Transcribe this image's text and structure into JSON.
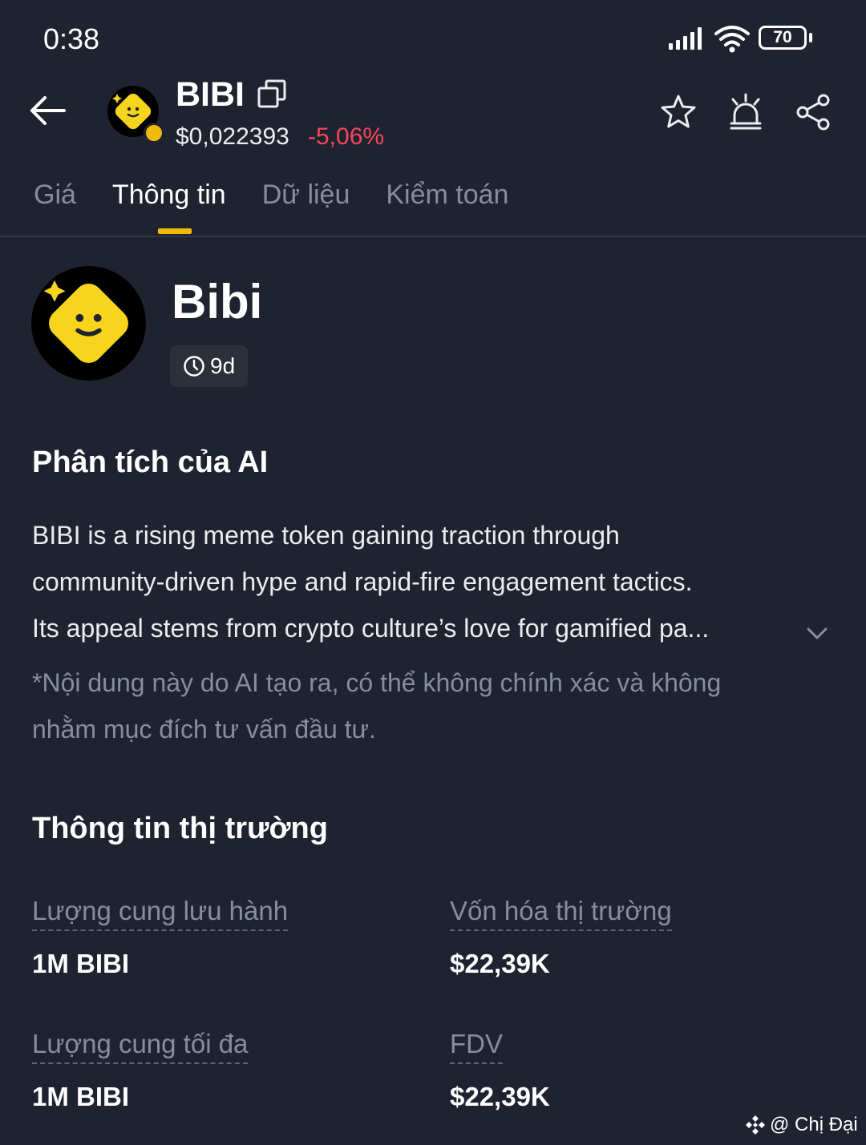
{
  "status_bar": {
    "time": "0:38",
    "battery": "70"
  },
  "header": {
    "symbol": "BIBI",
    "price": "$0,022393",
    "change": "-5,06%"
  },
  "tabs": [
    {
      "label": "Giá",
      "active": false
    },
    {
      "label": "Thông tin",
      "active": true
    },
    {
      "label": "Dữ liệu",
      "active": false
    },
    {
      "label": "Kiểm toán",
      "active": false
    }
  ],
  "token": {
    "name": "Bibi",
    "age": "9d"
  },
  "ai": {
    "heading": "Phân tích của AI",
    "lines": [
      "BIBI is a rising meme token gaining traction through",
      "community-driven hype and rapid-fire engagement tactics.",
      "Its appeal stems from crypto culture’s love for gamified pa..."
    ],
    "disclaimer_lines": [
      "*Nội dung này do AI tạo ra, có thể không chính xác và không",
      "nhằm mục đích tư vấn đầu tư."
    ]
  },
  "market": {
    "heading": "Thông tin thị trường",
    "circulating_label": "Lượng cung lưu hành",
    "circulating_value": "1M BIBI",
    "marketcap_label": "Vốn hóa thị trường",
    "marketcap_value": "$22,39K",
    "max_label": "Lượng cung tối đa",
    "max_value": "1M BIBI",
    "fdv_label": "FDV",
    "fdv_value": "$22,39K"
  },
  "watermark": "@ Chị Đại",
  "colors": {
    "background": "#1f2330",
    "accent": "#f0b90b",
    "negative": "#f6465d",
    "muted": "#848e9c"
  }
}
